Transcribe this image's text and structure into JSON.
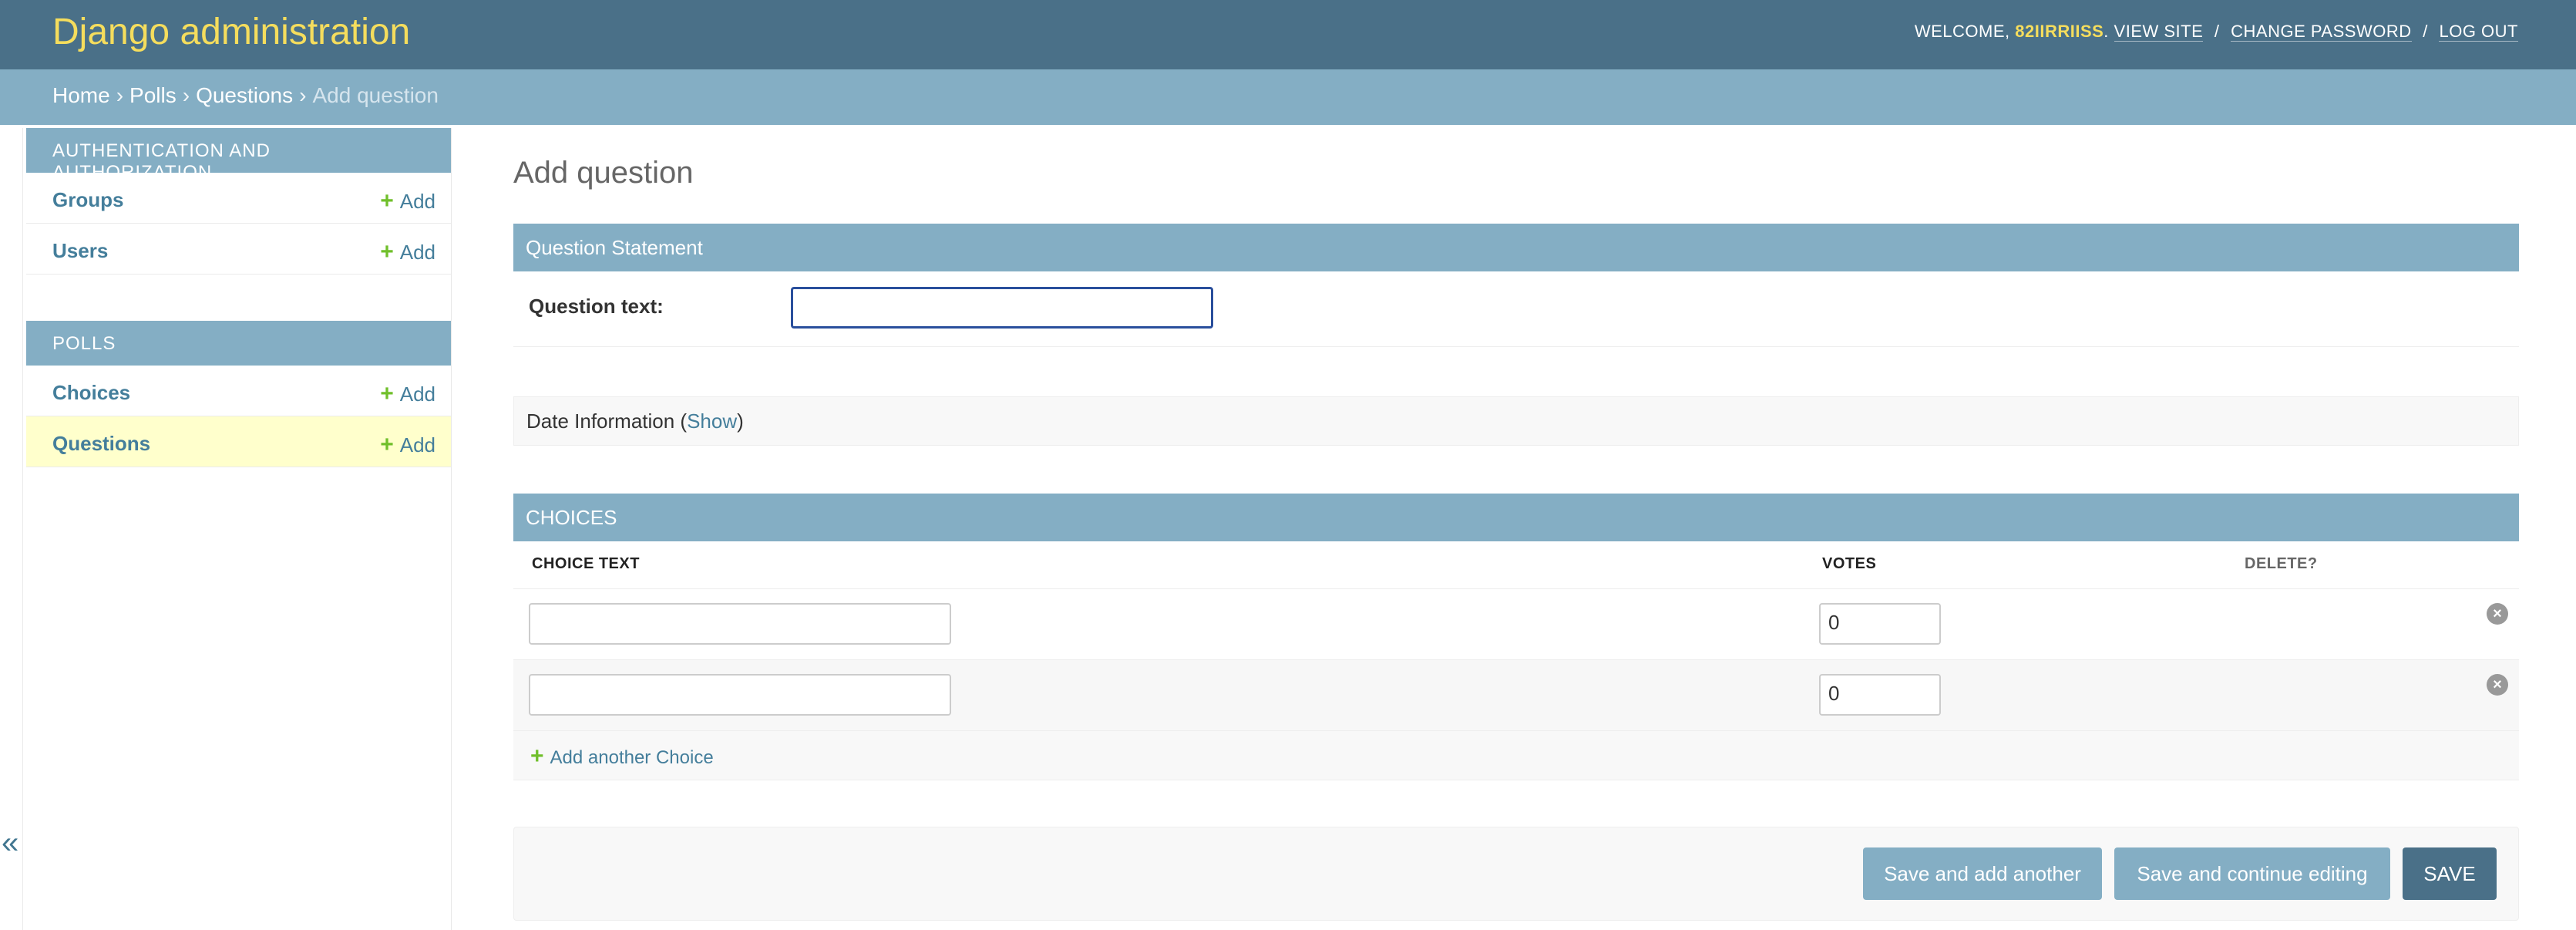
{
  "header": {
    "brand": "Django administration",
    "welcome_prefix": "WELCOME, ",
    "username": "82IIRRIISS",
    "view_site": "VIEW SITE",
    "change_password": "CHANGE PASSWORD",
    "logout": "LOG OUT"
  },
  "breadcrumbs": {
    "home": "Home",
    "app": "Polls",
    "model": "Questions",
    "current": "Add question"
  },
  "sidebar": {
    "modules": [
      {
        "caption": "AUTHENTICATION AND AUTHORIZATION",
        "items": [
          {
            "name": "Groups",
            "add": "Add"
          },
          {
            "name": "Users",
            "add": "Add"
          }
        ]
      },
      {
        "caption": "POLLS",
        "items": [
          {
            "name": "Choices",
            "add": "Add"
          },
          {
            "name": "Questions",
            "add": "Add"
          }
        ]
      }
    ],
    "collapse_icon": "double-chevron-left-icon"
  },
  "main": {
    "title": "Add question",
    "question_statement": {
      "caption": "Question Statement",
      "label": "Question text:",
      "value": ""
    },
    "date_information": {
      "label": "Date Information (",
      "show": "Show",
      "close": ")"
    },
    "choices": {
      "caption": "CHOICES",
      "columns": [
        "CHOICE TEXT",
        "VOTES",
        "DELETE?"
      ],
      "rows": [
        {
          "choice_text": "",
          "votes": "0"
        },
        {
          "choice_text": "",
          "votes": "0"
        }
      ],
      "add_another": "Add another Choice"
    },
    "buttons": {
      "save_add_another": "Save and add another",
      "save_continue": "Save and continue editing",
      "save": "SAVE"
    }
  },
  "colors": {
    "header_bg": "#4a7088",
    "breadcrumbs_bg": "#84aec4",
    "brand": "#f5dd5d",
    "link": "#447e9b",
    "add_plus": "#70bf2b",
    "active_row": "#ffffcc"
  }
}
